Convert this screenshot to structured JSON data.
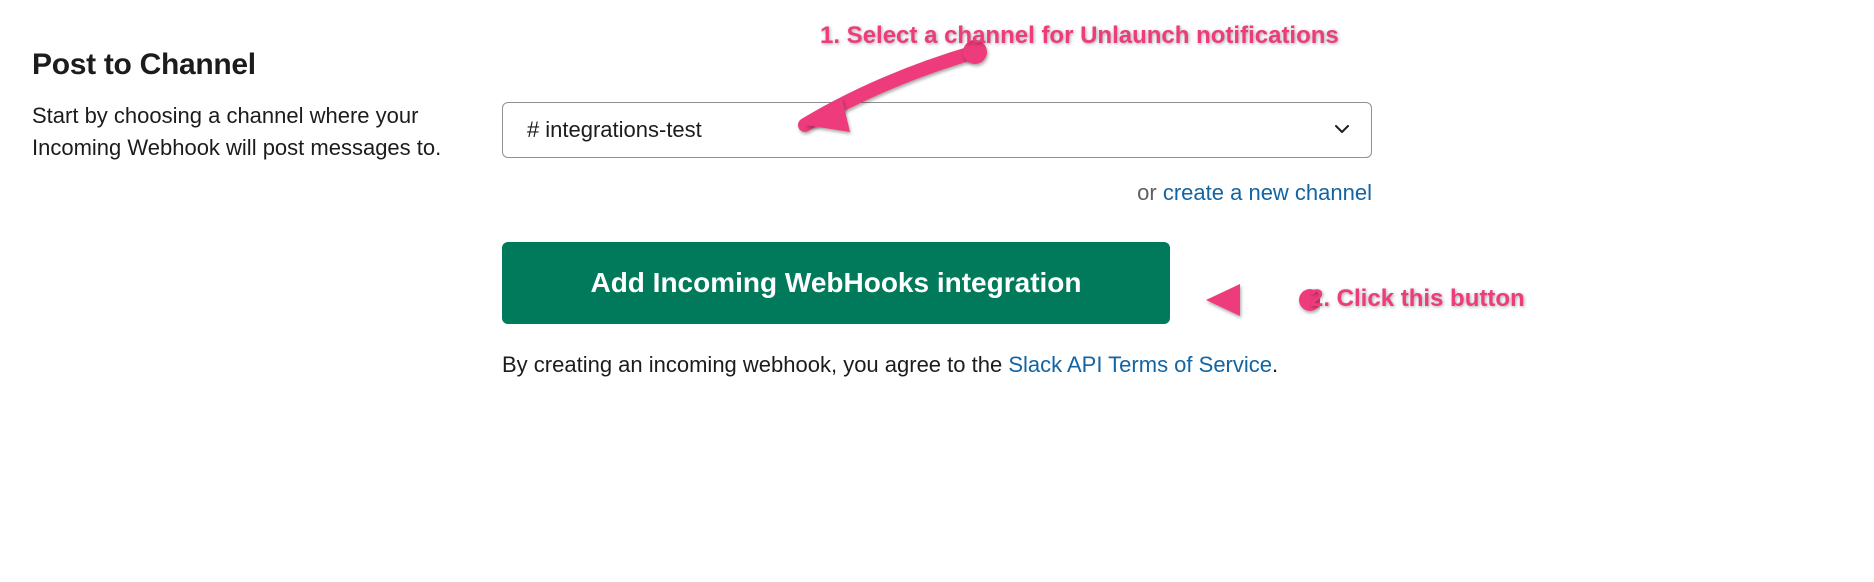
{
  "left": {
    "heading": "Post to Channel",
    "description": "Start by choosing a channel where your Incoming Webhook will post messages to."
  },
  "select": {
    "hash": "#",
    "value": "integrations-test"
  },
  "alt": {
    "or": "or ",
    "link": "create a new channel"
  },
  "button": {
    "label": "Add Incoming WebHooks integration"
  },
  "terms": {
    "prefix": "By creating an incoming webhook, you agree to the ",
    "link": "Slack API Terms of Service",
    "suffix": "."
  },
  "annotations": {
    "step1": "1. Select a channel for Unlaunch notifications",
    "step2": "2. Click this button"
  }
}
